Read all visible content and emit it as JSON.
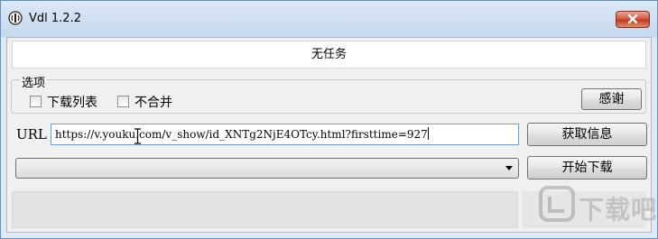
{
  "window": {
    "title": "Vdl 1.2.2"
  },
  "status": {
    "text": "无任务"
  },
  "options": {
    "group_label": "选项",
    "download_list_label": "下载列表",
    "no_merge_label": "不合并",
    "download_list_checked": false,
    "no_merge_checked": false,
    "thanks_button": "感谢"
  },
  "url": {
    "label": "URL",
    "value": "https://v.youku.com/v_show/id_XNTg2NjE4OTcy.html?firsttime=927",
    "get_info_button": "获取信息"
  },
  "download": {
    "format_selected": "",
    "start_button": "开始下载"
  },
  "watermark": {
    "text": "下载吧"
  },
  "colors": {
    "titlebar": "#c6d8ee",
    "client_bg": "#f0f0f0",
    "close_button": "#c23a23",
    "input_border": "#7a9cc6"
  }
}
